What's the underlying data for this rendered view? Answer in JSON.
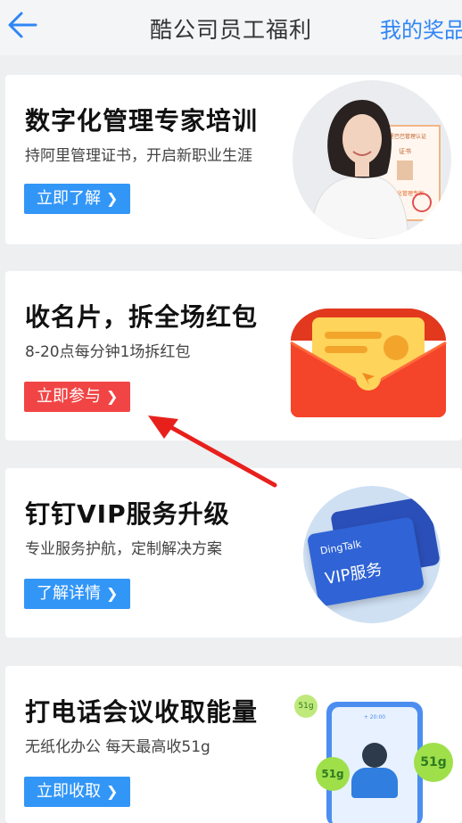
{
  "header": {
    "title": "酷公司员工福利",
    "my_prizes": "我的奖品"
  },
  "cards": [
    {
      "title": "数字化管理专家培训",
      "subtitle": "持阿里管理证书，开启新职业生涯",
      "button": "立即了解",
      "cert_header": "阿里巴巴管理认证",
      "cert_label": "证书",
      "cert_name": "数字化管理专家"
    },
    {
      "title": "收名片，拆全场红包",
      "subtitle": "8-20点每分钟1场拆红包",
      "button": "立即参与"
    },
    {
      "title": "钉钉VIP服务升级",
      "subtitle": "专业服务护航，定制解决方案",
      "button": "了解详情",
      "vip_brand": "DingTalk",
      "vip_text": "VIP服务"
    },
    {
      "title": "打电话会议收取能量",
      "subtitle": "无纸化办公 每天最高收51g",
      "button": "立即收取",
      "energy_badge": "51g",
      "phone_time": "+ 20:00"
    }
  ],
  "colors": {
    "accent_blue": "#3296f7",
    "accent_red": "#f14545",
    "link_blue": "#2f86f6",
    "arrow_red": "#e8201c"
  },
  "icons": {
    "back": "arrow-left-icon",
    "chevron": "chevron-right-icon"
  }
}
